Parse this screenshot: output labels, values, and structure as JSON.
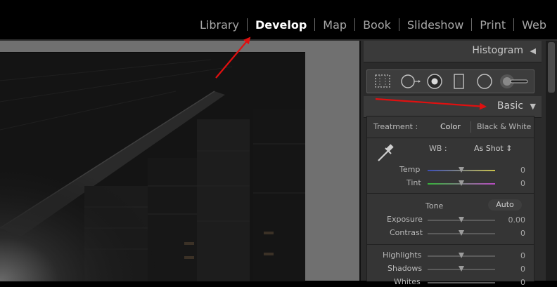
{
  "modules": [
    "Library",
    "Develop",
    "Map",
    "Book",
    "Slideshow",
    "Print",
    "Web"
  ],
  "active_module": "Develop",
  "panels": {
    "histogram": {
      "title": "Histogram",
      "arrow": "◀"
    },
    "basic": {
      "title": "Basic",
      "arrow": "▼"
    }
  },
  "tools": [
    "crop-overlay-icon",
    "spot-removal-icon",
    "red-eye-icon",
    "graduated-filter-icon",
    "radial-filter-icon",
    "adjustment-brush-icon"
  ],
  "treatment": {
    "label": "Treatment :",
    "color": "Color",
    "bw": "Black & White"
  },
  "wb": {
    "label": "WB :",
    "value": "As Shot ⇕"
  },
  "sliders": {
    "temp": {
      "label": "Temp",
      "value": "0"
    },
    "tint": {
      "label": "Tint",
      "value": "0"
    },
    "exposure": {
      "label": "Exposure",
      "value": "0.00"
    },
    "contrast": {
      "label": "Contrast",
      "value": "0"
    },
    "highlights": {
      "label": "Highlights",
      "value": "0"
    },
    "shadows": {
      "label": "Shadows",
      "value": "0"
    },
    "whites": {
      "label": "Whites",
      "value": "0"
    }
  },
  "tone": {
    "label": "Tone",
    "auto": "Auto"
  },
  "colors": {
    "annotation": "#e01010",
    "active_module": "#ffffff",
    "panel": "#2b2b2b"
  }
}
